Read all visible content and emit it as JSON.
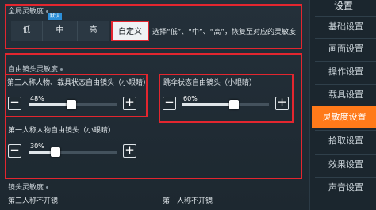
{
  "sidebar": {
    "title": "设置",
    "items": [
      {
        "label": "基础设置",
        "active": false
      },
      {
        "label": "画面设置",
        "active": false
      },
      {
        "label": "操作设置",
        "active": false
      },
      {
        "label": "载具设置",
        "active": false
      },
      {
        "label": "灵敏度设置",
        "active": true
      },
      {
        "label": "拾取设置",
        "active": false
      },
      {
        "label": "效果设置",
        "active": false
      },
      {
        "label": "声音设置",
        "active": false
      }
    ]
  },
  "global": {
    "title": "全局灵敏度",
    "badge": "默认",
    "options": [
      "低",
      "中",
      "高",
      "自定义"
    ],
    "selected": "自定义",
    "hint": "选择“低”、“中”、“高”，恢复至对应的灵敏度"
  },
  "free_camera": {
    "title": "自由镜头灵敏度",
    "sliders": [
      {
        "label": "第三人称人物、载具状态自由镜头（小眼睛）",
        "value": 48,
        "value_text": "48%"
      },
      {
        "label": "跳伞状态自由镜头（小眼睛）",
        "value": 60,
        "value_text": "60%"
      },
      {
        "label": "第一人称人物自由镜头（小眼睛）",
        "value": 30,
        "value_text": "30%"
      }
    ]
  },
  "camera": {
    "title": "镜头灵敏度",
    "col1": "第三人称不开镜",
    "col2": "第一人称不开镜"
  },
  "icons": {
    "minus": "−",
    "plus": "+"
  },
  "colors": {
    "accent": "#ff7a1a",
    "highlight": "#e3262f",
    "badge": "#2c8fd8"
  }
}
